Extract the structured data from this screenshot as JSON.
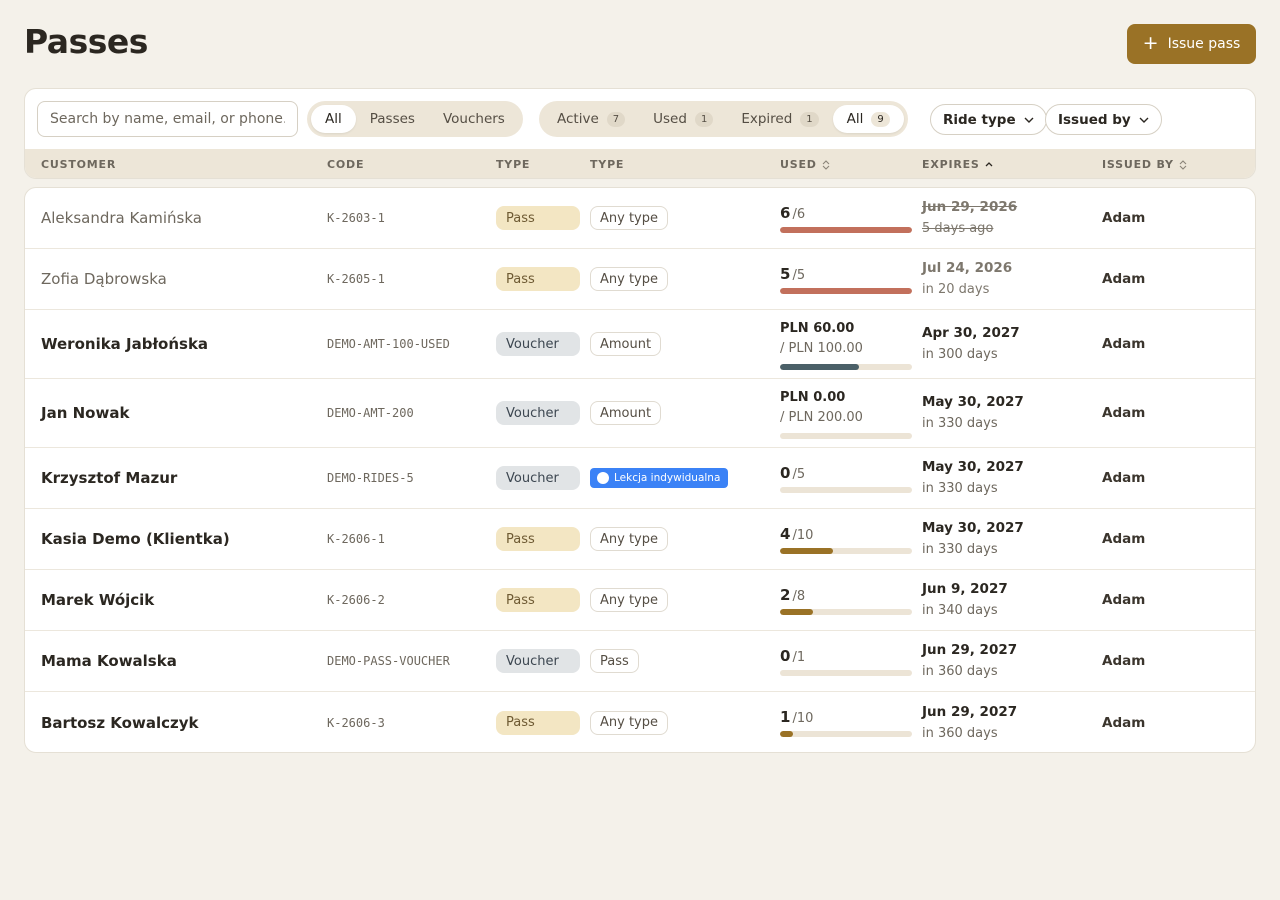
{
  "page": {
    "title": "Passes",
    "issue_button": {
      "icon": "plus-icon",
      "glyph": "+",
      "label": "Issue pass"
    }
  },
  "filters": {
    "search_placeholder": "Search by name, email, or phone…",
    "kind_tabs": [
      {
        "label": "All",
        "active": true
      },
      {
        "label": "Passes",
        "active": false
      },
      {
        "label": "Vouchers",
        "active": false
      }
    ],
    "status_tabs": [
      {
        "label": "Active",
        "count": "7",
        "active": false
      },
      {
        "label": "Used",
        "count": "1",
        "active": false
      },
      {
        "label": "Expired",
        "count": "1",
        "active": false
      },
      {
        "label": "All",
        "count": "9",
        "active": true
      }
    ],
    "ride_type": "Ride type",
    "issued_by": "Issued by"
  },
  "columns": {
    "customer": "CUSTOMER",
    "code": "CODE",
    "type": "TYPE",
    "type2": "TYPE",
    "used": "USED",
    "expires": "EXPIRES",
    "issued_by": "ISSUED BY"
  },
  "colors": {
    "accent": "#9a7226",
    "exhausted": "#c2705c",
    "amount": "#4b6068",
    "progress": "#9a7226",
    "ride_badge": "#3b82f6"
  },
  "rows": [
    {
      "customer": "Aleksandra Kamińska",
      "code": "K-2603-1",
      "type": "Pass",
      "kind": "Any type",
      "used": "6",
      "total": "/6",
      "fraction": 1,
      "bar": "exhausted",
      "expires": "Jun 29, 2026",
      "relative": "5 days ago",
      "expired": true,
      "muted": true,
      "issued_by": "Adam"
    },
    {
      "customer": "Zofia Dąbrowska",
      "code": "K-2605-1",
      "type": "Pass",
      "kind": "Any type",
      "used": "5",
      "total": "/5",
      "fraction": 1,
      "bar": "exhausted",
      "expires": "Jul 24, 2026",
      "relative": "in 20 days",
      "muted": true,
      "issued_by": "Adam"
    },
    {
      "customer": "Weronika Jabłońska",
      "code": "DEMO-AMT-100-USED",
      "type": "Voucher",
      "kind": "Amount",
      "amount": "PLN 60.00",
      "amount_total": "/ PLN 100.00",
      "fraction": 0.6,
      "bar": "amount",
      "expires": "Apr 30, 2027",
      "relative": "in 300 days",
      "issued_by": "Adam"
    },
    {
      "customer": "Jan Nowak",
      "code": "DEMO-AMT-200",
      "type": "Voucher",
      "kind": "Amount",
      "amount": "PLN 0.00",
      "amount_total": "/ PLN 200.00",
      "fraction": 0,
      "bar": "amount",
      "expires": "May 30, 2027",
      "relative": "in 330 days",
      "issued_by": "Adam"
    },
    {
      "customer": "Krzysztof Mazur",
      "code": "DEMO-RIDES-5",
      "type": "Voucher",
      "kind": "Lekcja indywidualna",
      "kind_style": "ride",
      "used": "0",
      "total": "/5",
      "fraction": 0,
      "bar": "progress",
      "expires": "May 30, 2027",
      "relative": "in 330 days",
      "issued_by": "Adam"
    },
    {
      "customer": "Kasia Demo (Klientka)",
      "code": "K-2606-1",
      "type": "Pass",
      "kind": "Any type",
      "used": "4",
      "total": "/10",
      "fraction": 0.4,
      "bar": "progress",
      "expires": "May 30, 2027",
      "relative": "in 330 days",
      "issued_by": "Adam"
    },
    {
      "customer": "Marek Wójcik",
      "code": "K-2606-2",
      "type": "Pass",
      "kind": "Any type",
      "used": "2",
      "total": "/8",
      "fraction": 0.25,
      "bar": "progress",
      "expires": "Jun 9, 2027",
      "relative": "in 340 days",
      "issued_by": "Adam"
    },
    {
      "customer": "Mama Kowalska",
      "code": "DEMO-PASS-VOUCHER",
      "type": "Voucher",
      "kind": "Pass",
      "used": "0",
      "total": "/1",
      "fraction": 0,
      "bar": "progress",
      "expires": "Jun 29, 2027",
      "relative": "in 360 days",
      "issued_by": "Adam"
    },
    {
      "customer": "Bartosz Kowalczyk",
      "code": "K-2606-3",
      "type": "Pass",
      "kind": "Any type",
      "used": "1",
      "total": "/10",
      "fraction": 0.1,
      "bar": "progress",
      "expires": "Jun 29, 2027",
      "relative": "in 360 days",
      "issued_by": "Adam"
    }
  ]
}
